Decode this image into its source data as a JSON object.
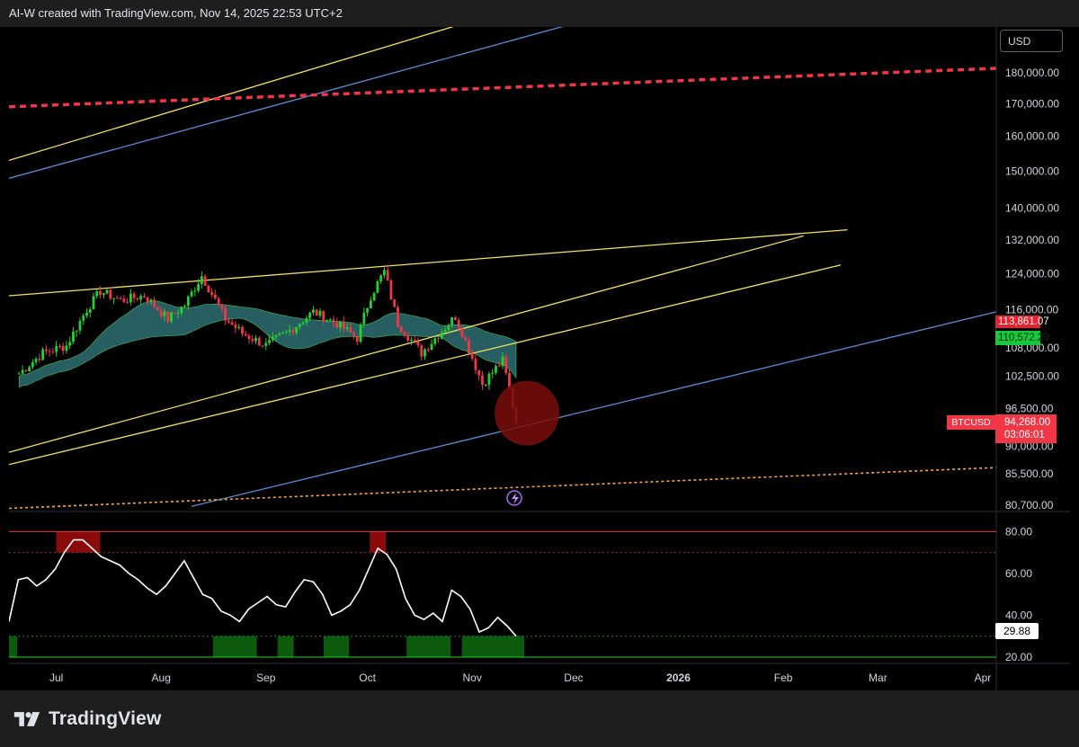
{
  "header": {
    "attribution": "AI-W created with TradingView.com, Nov 14, 2025 22:53 UTC+2"
  },
  "currency_label": "USD",
  "symbol": "BTCUSD",
  "price_tags": {
    "ma_upper": "113,861.07",
    "ma_lower": "110,572.29",
    "last_price": "94,268.00",
    "countdown": "03:06:01",
    "rsi_value": "29.88"
  },
  "brand": "TradingView",
  "colors": {
    "background": "#000000",
    "up_candle": "#22d12e",
    "down_candle": "#f23645",
    "trendline_yellow": "#f5e15a",
    "trendline_blue": "#5b8dd9",
    "resistance_red": "#f23645",
    "support_orange": "#f7a54a",
    "ma_ribbon": "#2e6f73",
    "highlight_circle": "#7a0d0d",
    "rsi_line": "#ffffff",
    "overbought_fill": "#8b0a0a",
    "oversold_fill": "#0c5b0c"
  },
  "chart_data": [
    {
      "type": "candlestick",
      "title": "",
      "symbol": "BTCUSD",
      "x_labels": [
        "Jul",
        "Aug",
        "Sep",
        "Oct",
        "Nov",
        "Dec",
        "2026",
        "Feb",
        "Mar",
        "Apr"
      ],
      "y_ticks": [
        180000,
        170000,
        160000,
        150000,
        140000,
        132000,
        124000,
        116000,
        108000,
        102500,
        96500,
        90000,
        85500,
        80700
      ],
      "y_tick_labels": [
        "180,000.00",
        "170,000.00",
        "160,000.00",
        "150,000.00",
        "140,000.00",
        "132,000.00",
        "124,000.00",
        "116,000.00",
        "108,000.00",
        "102,500.00",
        "96,500.00",
        "90,000.00",
        "85,500.00",
        "80,700.00"
      ],
      "ylim": [
        80000,
        196000
      ],
      "log_scale": true,
      "grid": false,
      "daily_closes": [
        {
          "date": "2025-06-20",
          "close": 103000
        },
        {
          "date": "2025-06-27",
          "close": 107000
        },
        {
          "date": "2025-07-04",
          "close": 108500
        },
        {
          "date": "2025-07-10",
          "close": 116000
        },
        {
          "date": "2025-07-14",
          "close": 120000
        },
        {
          "date": "2025-07-20",
          "close": 118000
        },
        {
          "date": "2025-07-27",
          "close": 119000
        },
        {
          "date": "2025-08-03",
          "close": 114000
        },
        {
          "date": "2025-08-08",
          "close": 117000
        },
        {
          "date": "2025-08-13",
          "close": 123500
        },
        {
          "date": "2025-08-20",
          "close": 114000
        },
        {
          "date": "2025-08-25",
          "close": 111000
        },
        {
          "date": "2025-09-01",
          "close": 108500
        },
        {
          "date": "2025-09-08",
          "close": 111500
        },
        {
          "date": "2025-09-15",
          "close": 115500
        },
        {
          "date": "2025-09-22",
          "close": 113000
        },
        {
          "date": "2025-09-28",
          "close": 110000
        },
        {
          "date": "2025-10-02",
          "close": 119000
        },
        {
          "date": "2025-10-06",
          "close": 124500
        },
        {
          "date": "2025-10-10",
          "close": 113000
        },
        {
          "date": "2025-10-17",
          "close": 107000
        },
        {
          "date": "2025-10-27",
          "close": 114500
        },
        {
          "date": "2025-11-04",
          "close": 101000
        },
        {
          "date": "2025-11-10",
          "close": 105500
        },
        {
          "date": "2025-11-14",
          "close": 94268
        }
      ],
      "last_price": 94268,
      "ma_ribbon_last": [
        110572.29,
        113861.07
      ],
      "trendlines": [
        {
          "color": "yellow",
          "start": {
            "date": "2025-06-17",
            "price": 153000
          },
          "end": {
            "date": "2025-12-09",
            "price": 213000
          }
        },
        {
          "color": "blue",
          "start": {
            "date": "2025-06-17",
            "price": 148000
          },
          "end": {
            "date": "2025-12-09",
            "price": 200000
          }
        },
        {
          "color": "red-dashed",
          "start": {
            "date": "2025-06-17",
            "price": 169000
          },
          "end": {
            "date": "2026-04-05",
            "price": 181500
          }
        },
        {
          "color": "yellow",
          "start": {
            "date": "2025-06-17",
            "price": 119000
          },
          "end": {
            "date": "2026-02-20",
            "price": 134500
          }
        },
        {
          "color": "yellow",
          "start": {
            "date": "2025-06-17",
            "price": 89000
          },
          "end": {
            "date": "2026-02-07",
            "price": 133000
          }
        },
        {
          "color": "yellow",
          "start": {
            "date": "2025-06-17",
            "price": 87000
          },
          "end": {
            "date": "2026-02-18",
            "price": 126000
          }
        },
        {
          "color": "blue",
          "start": {
            "date": "2025-08-10",
            "price": 80500
          },
          "end": {
            "date": "2026-04-05",
            "price": 115500
          }
        },
        {
          "color": "orange-dotted",
          "start": {
            "date": "2025-06-17",
            "price": 80200
          },
          "end": {
            "date": "2026-04-05",
            "price": 86500
          }
        }
      ]
    },
    {
      "type": "line",
      "title": "",
      "y_ticks": [
        80,
        60,
        40,
        20
      ],
      "y_tick_labels": [
        "80.00",
        "60.00",
        "40.00",
        "20.00"
      ],
      "ylim": [
        17,
        84
      ],
      "overbought": 70,
      "oversold": 30,
      "last_value": 29.88,
      "series": [
        {
          "values": [
            37,
            57,
            58,
            54,
            57,
            62,
            70,
            76,
            76,
            72,
            68,
            66,
            64,
            60,
            57,
            53,
            50,
            54,
            60,
            66,
            58,
            50,
            48,
            42,
            40,
            37,
            43,
            46,
            49,
            45,
            44,
            51,
            57,
            56,
            50,
            40,
            42,
            45,
            52,
            62,
            72,
            69,
            62,
            48,
            40,
            38,
            41,
            37,
            52,
            49,
            43,
            32,
            34,
            39,
            35,
            30
          ]
        }
      ]
    }
  ]
}
